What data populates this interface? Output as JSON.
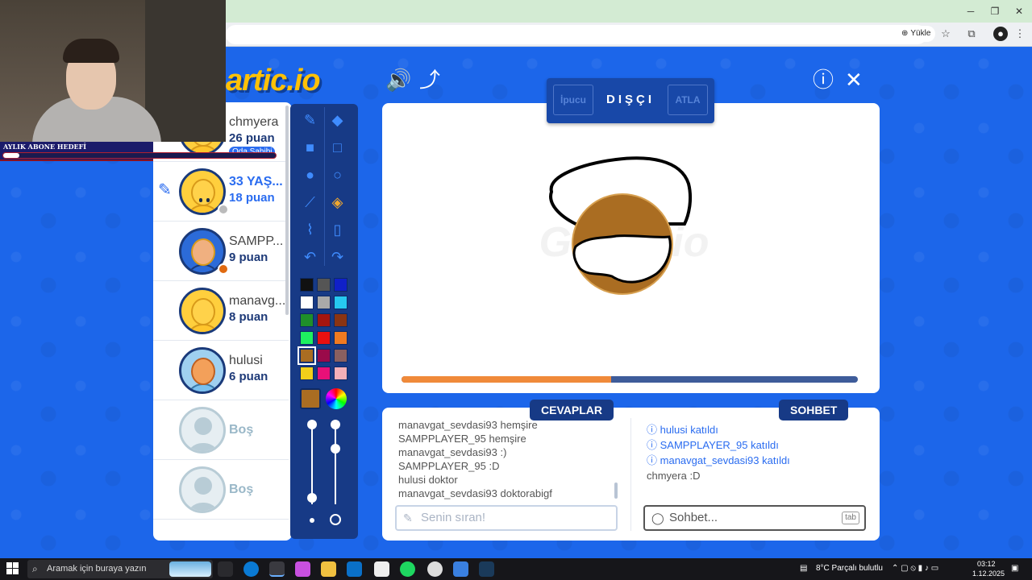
{
  "browser": {
    "install_chip": "Yükle",
    "install_icon": "install-icon",
    "minimize": "─",
    "restore": "❐",
    "close": "✕",
    "star": "☆",
    "extensions": "⧉",
    "menu": "⋮"
  },
  "overlay": {
    "goal_label": "AYLIK ABONE HEDEFİ",
    "goal_progress": 0.06
  },
  "game": {
    "logo": "artic.io",
    "sound_icon": "🔊",
    "share_icon": "⤴",
    "info_icon": "ⓘ",
    "close_icon": "✕",
    "hint_label": "İpucu",
    "word": "DIŞÇI",
    "skip_label": "ATLA",
    "timer_progress": 0.46,
    "players": [
      {
        "name": "chmyera",
        "score": "26 puan",
        "badge": "Oda Sahibi"
      },
      {
        "name": "33 YAŞ...",
        "score": "18 puan",
        "drawing": true
      },
      {
        "name": "SAMPP...",
        "score": "9 puan"
      },
      {
        "name": "manavg...",
        "score": "8 puan"
      },
      {
        "name": "hulusi",
        "score": "6 puan"
      },
      {
        "name": "Boş",
        "score": ""
      },
      {
        "name": "Boş",
        "score": ""
      }
    ],
    "palette": [
      "#111111",
      "#555555",
      "#1020c8",
      "#ffffff",
      "#a9a9a9",
      "#26c8f0",
      "#1f8f2a",
      "#a5150f",
      "#8a3412",
      "#1ef060",
      "#e81010",
      "#f07a20",
      "#aa6d22",
      "#9a0a4a",
      "#8a6060",
      "#f2cf1a",
      "#e81078",
      "#f4b0b8"
    ],
    "selected_color": "#aa6d22",
    "answers_tab": "CEVAPLAR",
    "chat_tab": "SOHBET",
    "answers": [
      {
        "user": "manavgat_sevdasi93",
        "msg": "hemşire"
      },
      {
        "user": "SAMPPLAYER_95",
        "msg": "hemşire"
      },
      {
        "user": "manavgat_sevdasi93",
        "msg": ":)"
      },
      {
        "user": "SAMPPLAYER_95",
        "msg": ":D"
      },
      {
        "user": "hulusi",
        "msg": "doktor"
      },
      {
        "user": "manavgat_sevdasi93",
        "msg": "doktorabigf"
      }
    ],
    "chat": [
      {
        "text": "hulusi katıldı",
        "system": true
      },
      {
        "text": "SAMPPLAYER_95 katıldı",
        "system": true
      },
      {
        "text": "manavgat_sevdasi93 katıldı",
        "system": true
      },
      {
        "text": "chmyera :D",
        "system": false
      }
    ],
    "answer_placeholder": "Senin sıran!",
    "chat_placeholder": "Sohbet...",
    "tab_key": "tab"
  },
  "taskbar": {
    "search_placeholder": "Aramak için buraya yazın",
    "weather": "8°C  Parçalı bulutlu",
    "time": "03:12",
    "date": "1.12.2025"
  }
}
